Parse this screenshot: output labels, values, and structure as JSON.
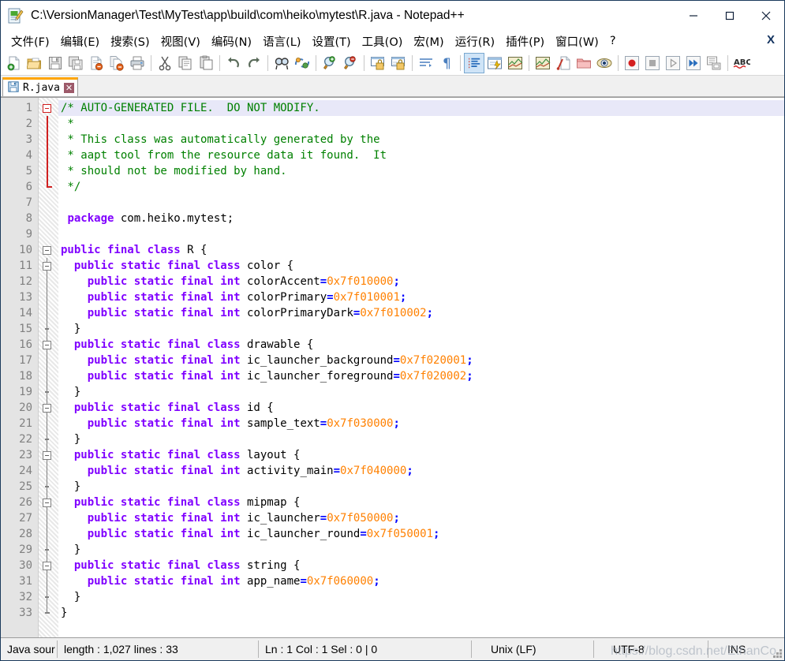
{
  "window": {
    "title": "C:\\VersionManager\\Test\\MyTest\\app\\build\\com\\heiko\\mytest\\R.java - Notepad++",
    "icon": "notepad-document-icon",
    "minimize_label": "—",
    "maximize_label": "☐",
    "close_label": "✕"
  },
  "menubar": {
    "items": [
      {
        "label": "文件(F)",
        "accel": "F"
      },
      {
        "label": "编辑(E)",
        "accel": "E"
      },
      {
        "label": "搜索(S)",
        "accel": "S"
      },
      {
        "label": "视图(V)",
        "accel": "V"
      },
      {
        "label": "编码(N)",
        "accel": "N"
      },
      {
        "label": "语言(L)",
        "accel": "L"
      },
      {
        "label": "设置(T)",
        "accel": "T"
      },
      {
        "label": "工具(O)",
        "accel": "O"
      },
      {
        "label": "宏(M)",
        "accel": "M"
      },
      {
        "label": "运行(R)",
        "accel": "R"
      },
      {
        "label": "插件(P)",
        "accel": "P"
      },
      {
        "label": "窗口(W)",
        "accel": "W"
      },
      {
        "label": "?",
        "accel": ""
      }
    ],
    "close_document_label": "X"
  },
  "toolbar": {
    "buttons": [
      {
        "name": "new-file-icon",
        "type": "icon"
      },
      {
        "name": "open-file-icon",
        "type": "icon"
      },
      {
        "name": "save-icon",
        "type": "icon"
      },
      {
        "name": "save-all-icon",
        "type": "icon"
      },
      {
        "name": "close-file-icon",
        "type": "icon"
      },
      {
        "name": "close-all-files-icon",
        "type": "icon"
      },
      {
        "name": "print-icon",
        "type": "icon"
      },
      {
        "name": "separator",
        "type": "sep"
      },
      {
        "name": "cut-icon",
        "type": "icon"
      },
      {
        "name": "copy-icon",
        "type": "icon"
      },
      {
        "name": "paste-icon",
        "type": "icon"
      },
      {
        "name": "separator",
        "type": "sep"
      },
      {
        "name": "undo-icon",
        "type": "icon"
      },
      {
        "name": "redo-icon",
        "type": "icon"
      },
      {
        "name": "separator",
        "type": "sep"
      },
      {
        "name": "find-icon",
        "type": "icon"
      },
      {
        "name": "replace-icon",
        "type": "icon"
      },
      {
        "name": "separator",
        "type": "sep"
      },
      {
        "name": "zoom-in-icon",
        "type": "icon"
      },
      {
        "name": "zoom-out-icon",
        "type": "icon"
      },
      {
        "name": "separator",
        "type": "sep"
      },
      {
        "name": "sync-vertical-scroll-icon",
        "type": "icon"
      },
      {
        "name": "sync-horizontal-scroll-icon",
        "type": "icon"
      },
      {
        "name": "separator",
        "type": "sep"
      },
      {
        "name": "word-wrap-icon",
        "type": "icon"
      },
      {
        "name": "show-all-characters-icon",
        "type": "icon"
      },
      {
        "name": "separator",
        "type": "sep"
      },
      {
        "name": "indent-guide-icon",
        "type": "icon",
        "active": true
      },
      {
        "name": "user-defined-language-icon",
        "type": "icon"
      },
      {
        "name": "document-map-icon",
        "type": "icon"
      },
      {
        "name": "separator",
        "type": "sep"
      },
      {
        "name": "document-map-2-icon",
        "type": "icon"
      },
      {
        "name": "function-list-icon",
        "type": "icon"
      },
      {
        "name": "folder-as-workspace-icon",
        "type": "icon"
      },
      {
        "name": "monitoring-icon",
        "type": "icon"
      },
      {
        "name": "separator",
        "type": "sep"
      },
      {
        "name": "macro-record-icon",
        "type": "icon"
      },
      {
        "name": "macro-stop-icon",
        "type": "icon"
      },
      {
        "name": "macro-play-icon",
        "type": "icon"
      },
      {
        "name": "macro-playback-multiple-icon",
        "type": "icon"
      },
      {
        "name": "macro-save-icon",
        "type": "icon"
      },
      {
        "name": "separator",
        "type": "sep"
      },
      {
        "name": "spell-check-icon",
        "type": "icon"
      }
    ]
  },
  "tabs": [
    {
      "label": "R.java",
      "icon": "save-blue-icon",
      "close": "✕",
      "active": true
    }
  ],
  "editor": {
    "total_lines": 33,
    "current_line": 1,
    "lines": [
      {
        "n": 1,
        "fold": "open-red",
        "tokens": [
          {
            "t": "/* AUTO-GENERATED FILE.  DO NOT MODIFY.",
            "c": "cmt"
          }
        ]
      },
      {
        "n": 2,
        "fold": "bar-red",
        "tokens": [
          {
            "t": " *",
            "c": "cmt"
          }
        ]
      },
      {
        "n": 3,
        "fold": "bar-red",
        "tokens": [
          {
            "t": " * This class was automatically generated by the",
            "c": "cmt"
          }
        ]
      },
      {
        "n": 4,
        "fold": "bar-red",
        "tokens": [
          {
            "t": " * aapt tool from the resource data it found.  It",
            "c": "cmt"
          }
        ]
      },
      {
        "n": 5,
        "fold": "bar-red",
        "tokens": [
          {
            "t": " * should not be modified by hand.",
            "c": "cmt"
          }
        ]
      },
      {
        "n": 6,
        "fold": "end-red",
        "tokens": [
          {
            "t": " */",
            "c": "cmt"
          }
        ]
      },
      {
        "n": 7,
        "fold": "none",
        "tokens": []
      },
      {
        "n": 8,
        "fold": "none",
        "tokens": [
          {
            "t": " ",
            "c": "id"
          },
          {
            "t": "package",
            "c": "kw"
          },
          {
            "t": " com.heiko.mytest;",
            "c": "id"
          }
        ]
      },
      {
        "n": 9,
        "fold": "none",
        "tokens": []
      },
      {
        "n": 10,
        "fold": "open",
        "tokens": [
          {
            "t": "public final class",
            "c": "kw"
          },
          {
            "t": " R {",
            "c": "id"
          }
        ]
      },
      {
        "n": 11,
        "fold": "open-i1",
        "tokens": [
          {
            "t": "  ",
            "c": "id"
          },
          {
            "t": "public static final class",
            "c": "kw"
          },
          {
            "t": " color {",
            "c": "id"
          }
        ]
      },
      {
        "n": 12,
        "fold": "bar",
        "tokens": [
          {
            "t": "    ",
            "c": "id"
          },
          {
            "t": "public static final int",
            "c": "kw"
          },
          {
            "t": " colorAccent",
            "c": "id"
          },
          {
            "t": "=",
            "c": "op"
          },
          {
            "t": "0x7f010000",
            "c": "num"
          },
          {
            "t": ";",
            "c": "op"
          }
        ]
      },
      {
        "n": 13,
        "fold": "bar",
        "tokens": [
          {
            "t": "    ",
            "c": "id"
          },
          {
            "t": "public static final int",
            "c": "kw"
          },
          {
            "t": " colorPrimary",
            "c": "id"
          },
          {
            "t": "=",
            "c": "op"
          },
          {
            "t": "0x7f010001",
            "c": "num"
          },
          {
            "t": ";",
            "c": "op"
          }
        ]
      },
      {
        "n": 14,
        "fold": "bar",
        "tokens": [
          {
            "t": "    ",
            "c": "id"
          },
          {
            "t": "public static final int",
            "c": "kw"
          },
          {
            "t": " colorPrimaryDark",
            "c": "id"
          },
          {
            "t": "=",
            "c": "op"
          },
          {
            "t": "0x7f010002",
            "c": "num"
          },
          {
            "t": ";",
            "c": "op"
          }
        ]
      },
      {
        "n": 15,
        "fold": "end-i1",
        "tokens": [
          {
            "t": "  }",
            "c": "id"
          }
        ]
      },
      {
        "n": 16,
        "fold": "open-i1",
        "tokens": [
          {
            "t": "  ",
            "c": "id"
          },
          {
            "t": "public static final class",
            "c": "kw"
          },
          {
            "t": " drawable {",
            "c": "id"
          }
        ]
      },
      {
        "n": 17,
        "fold": "bar",
        "tokens": [
          {
            "t": "    ",
            "c": "id"
          },
          {
            "t": "public static final int",
            "c": "kw"
          },
          {
            "t": " ic_launcher_background",
            "c": "id"
          },
          {
            "t": "=",
            "c": "op"
          },
          {
            "t": "0x7f020001",
            "c": "num"
          },
          {
            "t": ";",
            "c": "op"
          }
        ]
      },
      {
        "n": 18,
        "fold": "bar",
        "tokens": [
          {
            "t": "    ",
            "c": "id"
          },
          {
            "t": "public static final int",
            "c": "kw"
          },
          {
            "t": " ic_launcher_foreground",
            "c": "id"
          },
          {
            "t": "=",
            "c": "op"
          },
          {
            "t": "0x7f020002",
            "c": "num"
          },
          {
            "t": ";",
            "c": "op"
          }
        ]
      },
      {
        "n": 19,
        "fold": "end-i1",
        "tokens": [
          {
            "t": "  }",
            "c": "id"
          }
        ]
      },
      {
        "n": 20,
        "fold": "open-i1",
        "tokens": [
          {
            "t": "  ",
            "c": "id"
          },
          {
            "t": "public static final class",
            "c": "kw"
          },
          {
            "t": " id {",
            "c": "id"
          }
        ]
      },
      {
        "n": 21,
        "fold": "bar",
        "tokens": [
          {
            "t": "    ",
            "c": "id"
          },
          {
            "t": "public static final int",
            "c": "kw"
          },
          {
            "t": " sample_text",
            "c": "id"
          },
          {
            "t": "=",
            "c": "op"
          },
          {
            "t": "0x7f030000",
            "c": "num"
          },
          {
            "t": ";",
            "c": "op"
          }
        ]
      },
      {
        "n": 22,
        "fold": "end-i1",
        "tokens": [
          {
            "t": "  }",
            "c": "id"
          }
        ]
      },
      {
        "n": 23,
        "fold": "open-i1",
        "tokens": [
          {
            "t": "  ",
            "c": "id"
          },
          {
            "t": "public static final class",
            "c": "kw"
          },
          {
            "t": " layout {",
            "c": "id"
          }
        ]
      },
      {
        "n": 24,
        "fold": "bar",
        "tokens": [
          {
            "t": "    ",
            "c": "id"
          },
          {
            "t": "public static final int",
            "c": "kw"
          },
          {
            "t": " activity_main",
            "c": "id"
          },
          {
            "t": "=",
            "c": "op"
          },
          {
            "t": "0x7f040000",
            "c": "num"
          },
          {
            "t": ";",
            "c": "op"
          }
        ]
      },
      {
        "n": 25,
        "fold": "end-i1",
        "tokens": [
          {
            "t": "  }",
            "c": "id"
          }
        ]
      },
      {
        "n": 26,
        "fold": "open-i1",
        "tokens": [
          {
            "t": "  ",
            "c": "id"
          },
          {
            "t": "public static final class",
            "c": "kw"
          },
          {
            "t": " mipmap {",
            "c": "id"
          }
        ]
      },
      {
        "n": 27,
        "fold": "bar",
        "tokens": [
          {
            "t": "    ",
            "c": "id"
          },
          {
            "t": "public static final int",
            "c": "kw"
          },
          {
            "t": " ic_launcher",
            "c": "id"
          },
          {
            "t": "=",
            "c": "op"
          },
          {
            "t": "0x7f050000",
            "c": "num"
          },
          {
            "t": ";",
            "c": "op"
          }
        ]
      },
      {
        "n": 28,
        "fold": "bar",
        "tokens": [
          {
            "t": "    ",
            "c": "id"
          },
          {
            "t": "public static final int",
            "c": "kw"
          },
          {
            "t": " ic_launcher_round",
            "c": "id"
          },
          {
            "t": "=",
            "c": "op"
          },
          {
            "t": "0x7f050001",
            "c": "num"
          },
          {
            "t": ";",
            "c": "op"
          }
        ]
      },
      {
        "n": 29,
        "fold": "end-i1",
        "tokens": [
          {
            "t": "  }",
            "c": "id"
          }
        ]
      },
      {
        "n": 30,
        "fold": "open-i1",
        "tokens": [
          {
            "t": "  ",
            "c": "id"
          },
          {
            "t": "public static final class",
            "c": "kw"
          },
          {
            "t": " string {",
            "c": "id"
          }
        ]
      },
      {
        "n": 31,
        "fold": "bar",
        "tokens": [
          {
            "t": "    ",
            "c": "id"
          },
          {
            "t": "public static final int",
            "c": "kw"
          },
          {
            "t": " app_name",
            "c": "id"
          },
          {
            "t": "=",
            "c": "op"
          },
          {
            "t": "0x7f060000",
            "c": "num"
          },
          {
            "t": ";",
            "c": "op"
          }
        ]
      },
      {
        "n": 32,
        "fold": "end-i1",
        "tokens": [
          {
            "t": "  }",
            "c": "id"
          }
        ]
      },
      {
        "n": 33,
        "fold": "end",
        "tokens": [
          {
            "t": "}",
            "c": "id"
          }
        ]
      }
    ]
  },
  "statusbar": {
    "language": "Java source file",
    "language_visible": "Java sour",
    "length_lines": "length : 1,027    lines : 33",
    "caret": "Ln : 1    Col : 1    Sel : 0 | 0",
    "eol": "Unix (LF)",
    "encoding": "UTF-8",
    "insert_mode": "INS"
  },
  "watermark": "https://blog.csdn.net/EthanCo",
  "colors": {
    "keyword": "#8000ff",
    "comment": "#008000",
    "number": "#ff8000",
    "operator": "#0000ff",
    "identifier": "#000000",
    "current_line_bg": "#e8e8f8",
    "gutter_bg": "#e4e4e4",
    "tab_active_top": "#ffa500",
    "toolbar_active_bg": "#cfe4f7",
    "window_border": "#1b3a5c"
  }
}
